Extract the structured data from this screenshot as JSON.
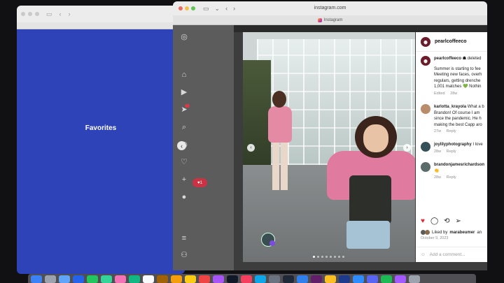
{
  "back_window": {
    "label": "Favorites"
  },
  "front_window": {
    "url": "instagram.com",
    "tab_title": "Instagram",
    "like_badge": "1"
  },
  "post": {
    "author": "pearlcoffeeco",
    "caption_author": "pearlcoffeeco",
    "caption_header": "deleted",
    "caption_lines": [
      "Summer is starting to fee",
      "Meeting new faces, overh",
      "regulars, getting drenche",
      "1,001 matches 💚 Nothin"
    ],
    "caption_meta": [
      "Edited",
      "28w"
    ],
    "comments": [
      {
        "user": "karlotta_krayola",
        "lines": [
          "What a b",
          "Brandon! Of course I am",
          "since the pandemic. He h",
          "making the best Capp aro"
        ],
        "time": "27w",
        "reply": "Reply"
      },
      {
        "user": "joylilyphotography",
        "lines": [
          "I love"
        ],
        "time": "28w",
        "reply": "Reply"
      },
      {
        "user": "brandonjamesrichardson",
        "lines": [
          "👏"
        ],
        "time": "28w",
        "reply": "Reply"
      }
    ],
    "liked_by_prefix": "Liked by",
    "liked_by_user": "marabeumer",
    "liked_by_suffix": "an",
    "date": "October 9, 2023",
    "add_comment_placeholder": "Add a comment..."
  },
  "colors": {
    "favorites_bg": "#2f43b8",
    "heart": "#e02a3c",
    "notification": "#d63a48"
  },
  "dock_icons": [
    "finder",
    "launchpad",
    "safari",
    "mail",
    "messages",
    "maps",
    "photos",
    "facetime",
    "calendar",
    "contacts",
    "reminders",
    "notes",
    "music",
    "podcasts",
    "tv",
    "news",
    "appstore",
    "settings",
    "terminal",
    "vscode",
    "slack",
    "chrome",
    "photoshop",
    "zoom",
    "discord",
    "spotify",
    "figma",
    "trash"
  ]
}
